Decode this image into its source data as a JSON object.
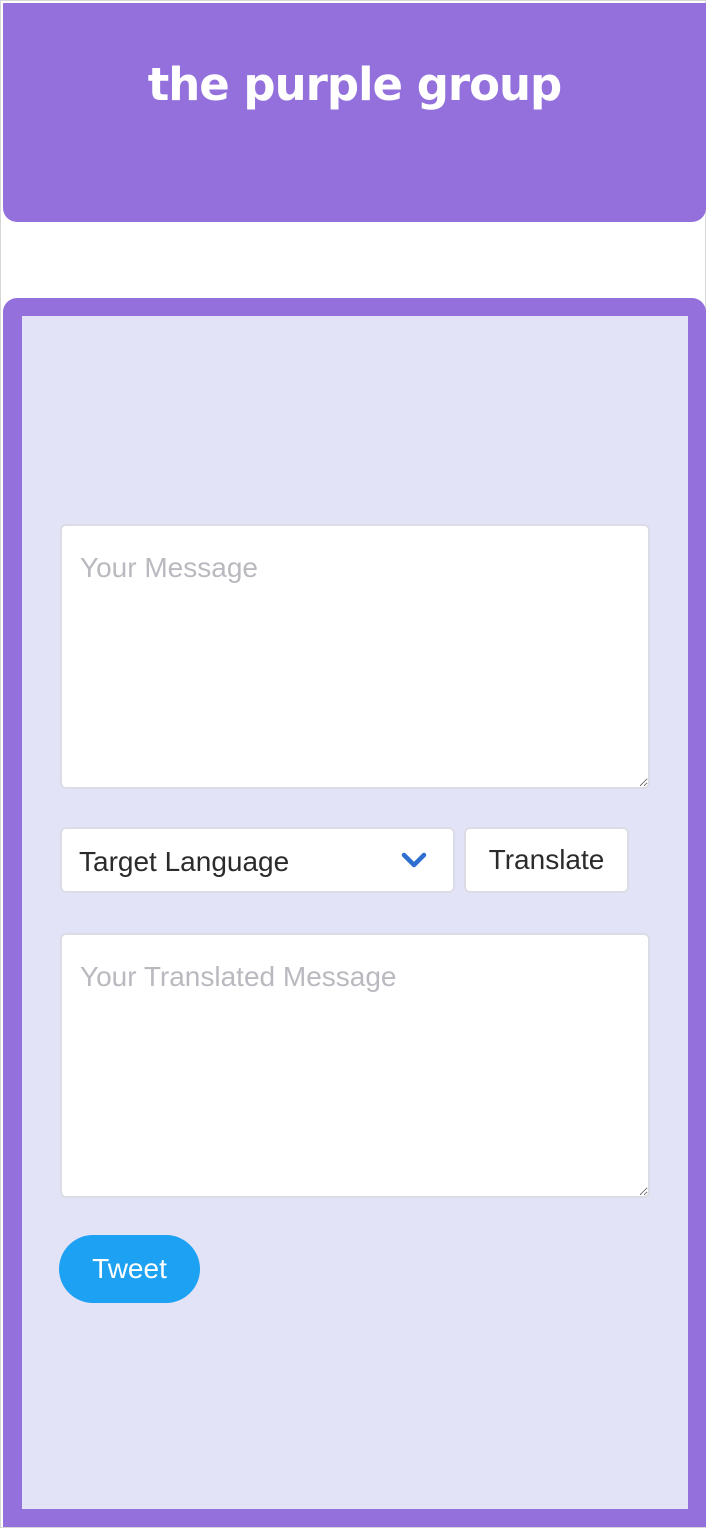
{
  "header": {
    "brand": "the purple group"
  },
  "form": {
    "message_placeholder": "Your Message",
    "language_select": {
      "selected": "Target Language"
    },
    "translate_label": "Translate",
    "translated_placeholder": "Your Translated Message",
    "tweet_label": "Tweet"
  },
  "icons": {
    "select_arrow": "chevron-down-icon"
  },
  "colors": {
    "brand_purple": "#9370db",
    "panel_background": "#e3e3f7",
    "tweet_blue": "#1da1f2",
    "chevron_blue": "#2f6fd0"
  }
}
